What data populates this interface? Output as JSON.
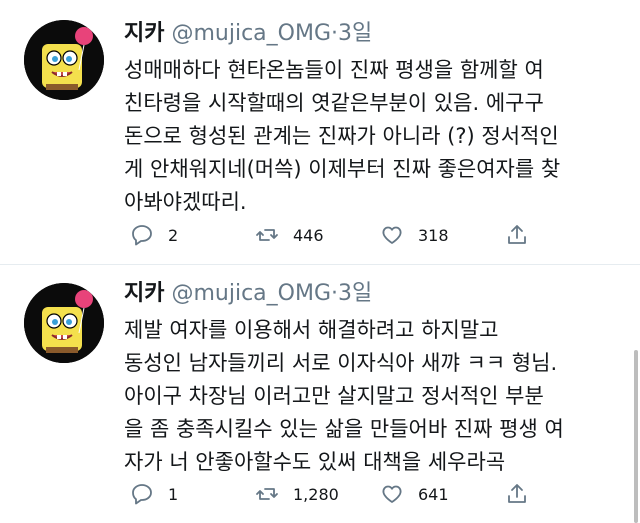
{
  "tweets": [
    {
      "name": "지카",
      "handle": "@mujica_OMG",
      "dot": "·",
      "time": "3일",
      "text": "성매매하다 현타온놈들이 진짜 평생을 함께할 여\n친타령을 시작할때의 엿같은부분이 있음. 에구구\n돈으로 형성된 관계는 진짜가 아니라 (?) 정서적인\n게 안채워지네(머쓱) 이제부터 진짜 좋은여자를 찾\n아봐야겠따리.",
      "replies": "2",
      "retweets": "446",
      "likes": "318"
    },
    {
      "name": "지카",
      "handle": "@mujica_OMG",
      "dot": "·",
      "time": "3일",
      "text": "제발 여자를 이용해서 해결하려고 하지말고\n동성인 남자들끼리 서로 이자식아 새꺄 ㅋㅋ 형님.\n아이구 차장님 이러고만 살지말고 정서적인 부분\n을 좀 충족시킬수 있는 삶을 만들어바 진짜 평생 여\n자가 너 안좋아할수도 있써 대책을 세우라곡",
      "replies": "1",
      "retweets": "1,280",
      "likes": "641"
    }
  ],
  "icons": {
    "reply": "reply-icon",
    "retweet": "retweet-icon",
    "like": "like-icon",
    "share": "share-icon"
  },
  "colors": {
    "text": "#14171a",
    "muted": "#657786",
    "divider": "#e6ecf0"
  }
}
